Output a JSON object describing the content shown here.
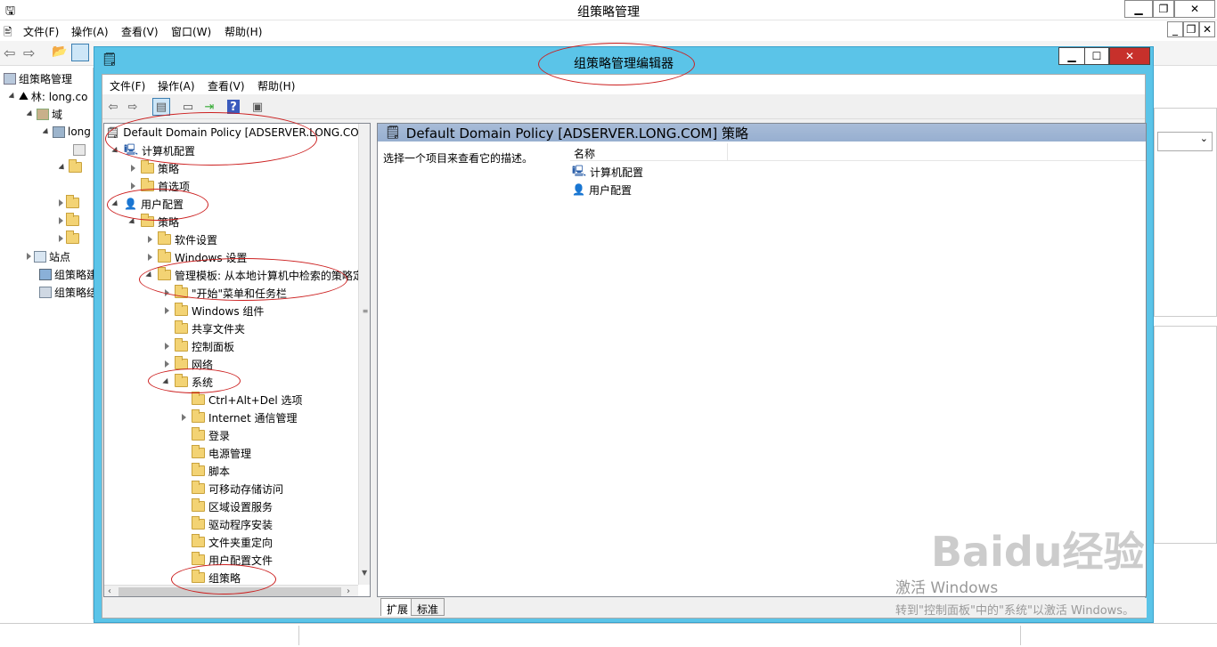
{
  "outer": {
    "title": "组策略管理",
    "menu": [
      "文件(F)",
      "操作(A)",
      "查看(V)",
      "窗口(W)",
      "帮助(H)"
    ],
    "tree": [
      {
        "label": "组策略管理",
        "indent": 0
      },
      {
        "label": "林: long.co",
        "indent": 1
      },
      {
        "label": "域",
        "indent": 2
      },
      {
        "label": "long",
        "indent": 3
      },
      {
        "label": "站点",
        "indent": 1
      },
      {
        "label": "组策略建",
        "indent": 1
      },
      {
        "label": "组策略结",
        "indent": 1
      }
    ]
  },
  "editor": {
    "title": "组策略管理编辑器",
    "menu": [
      "文件(F)",
      "操作(A)",
      "查看(V)",
      "帮助(H)"
    ],
    "tree": [
      {
        "label": "Default Domain Policy [ADSERVER.LONG.COM",
        "indent": 0,
        "exp": "",
        "icon": "policy"
      },
      {
        "label": "计算机配置",
        "indent": 0,
        "exp": "down",
        "icon": "computer"
      },
      {
        "label": "策略",
        "indent": 1,
        "exp": "right",
        "icon": "folder"
      },
      {
        "label": "首选项",
        "indent": 1,
        "exp": "right",
        "icon": "folder"
      },
      {
        "label": "用户配置",
        "indent": 0,
        "exp": "down",
        "icon": "user"
      },
      {
        "label": "策略",
        "indent": 1,
        "exp": "down",
        "icon": "folder"
      },
      {
        "label": "软件设置",
        "indent": 2,
        "exp": "right",
        "icon": "folder"
      },
      {
        "label": "Windows 设置",
        "indent": 2,
        "exp": "right",
        "icon": "folder"
      },
      {
        "label": "管理模板: 从本地计算机中检索的策略定",
        "indent": 2,
        "exp": "down",
        "icon": "folder"
      },
      {
        "label": "\"开始\"菜单和任务栏",
        "indent": 3,
        "exp": "right",
        "icon": "folder"
      },
      {
        "label": "Windows 组件",
        "indent": 3,
        "exp": "right",
        "icon": "folder"
      },
      {
        "label": "共享文件夹",
        "indent": 3,
        "exp": "",
        "icon": "folder"
      },
      {
        "label": "控制面板",
        "indent": 3,
        "exp": "right",
        "icon": "folder"
      },
      {
        "label": "网络",
        "indent": 3,
        "exp": "right",
        "icon": "folder"
      },
      {
        "label": "系统",
        "indent": 3,
        "exp": "down",
        "icon": "folder"
      },
      {
        "label": "Ctrl+Alt+Del 选项",
        "indent": 4,
        "exp": "",
        "icon": "folder"
      },
      {
        "label": "Internet 通信管理",
        "indent": 4,
        "exp": "right",
        "icon": "folder"
      },
      {
        "label": "登录",
        "indent": 4,
        "exp": "",
        "icon": "folder"
      },
      {
        "label": "电源管理",
        "indent": 4,
        "exp": "",
        "icon": "folder"
      },
      {
        "label": "脚本",
        "indent": 4,
        "exp": "",
        "icon": "folder"
      },
      {
        "label": "可移动存储访问",
        "indent": 4,
        "exp": "",
        "icon": "folder"
      },
      {
        "label": "区域设置服务",
        "indent": 4,
        "exp": "",
        "icon": "folder"
      },
      {
        "label": "驱动程序安装",
        "indent": 4,
        "exp": "",
        "icon": "folder"
      },
      {
        "label": "文件夹重定向",
        "indent": 4,
        "exp": "",
        "icon": "folder"
      },
      {
        "label": "用户配置文件",
        "indent": 4,
        "exp": "",
        "icon": "folder"
      },
      {
        "label": "组策略",
        "indent": 4,
        "exp": "",
        "icon": "folder"
      }
    ],
    "right": {
      "header": "Default Domain Policy [ADSERVER.LONG.COM] 策略",
      "description": "选择一个项目来查看它的描述。",
      "column_name": "名称",
      "items": [
        "计算机配置",
        "用户配置"
      ]
    },
    "tabs": [
      "扩展",
      "标准"
    ]
  },
  "watermark": {
    "line1": "激活 Windows",
    "line2": "转到\"控制面板\"中的\"系统\"以激活 Windows。",
    "baidu": "Baidu经验"
  }
}
